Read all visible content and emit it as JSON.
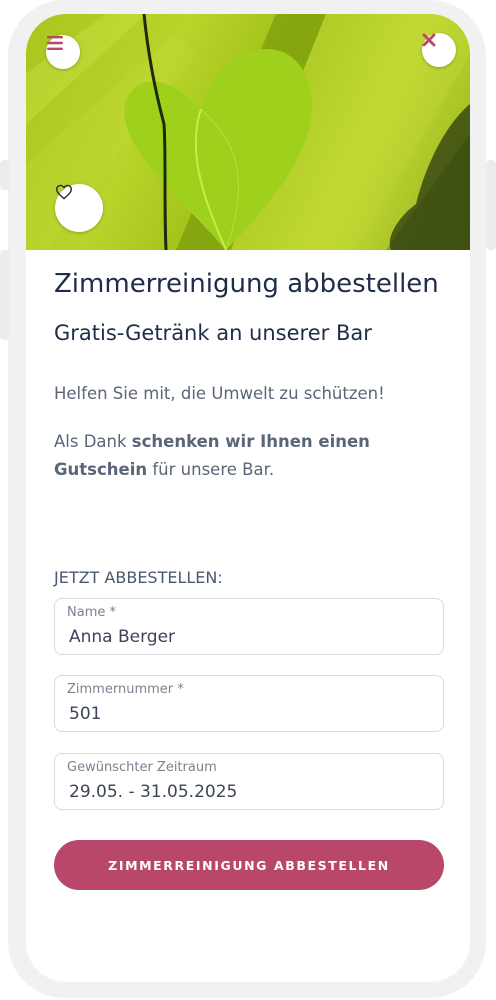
{
  "hero": {
    "menu_icon": "hamburger-menu-icon",
    "close_icon": "close-x-icon",
    "favorite_icon": "heart-outline-icon"
  },
  "content": {
    "title": "Zimmerreinigung abbestellen",
    "subtitle": "Gratis-Getränk an unserer Bar",
    "intro": "Helfen Sie mit, die Umwelt zu schützen!",
    "thanks_prefix": "Als Dank ",
    "thanks_bold": "schenken wir Ihnen einen Gutschein",
    "thanks_suffix": " für unsere Bar."
  },
  "form": {
    "heading": "JETZT ABBESTELLEN:",
    "fields": [
      {
        "label": "Name *",
        "value": "Anna Berger"
      },
      {
        "label": "Zimmernummer *",
        "value": "501"
      },
      {
        "label": "Gewünschter Zeitraum",
        "value": "29.05. - 31.05.2025"
      }
    ],
    "submit_label": "ZIMMERREINIGUNG ABBESTELLEN"
  },
  "colors": {
    "accent": "#b9476a",
    "text_dark": "#1f2d4a",
    "text_muted": "#5a6578"
  }
}
